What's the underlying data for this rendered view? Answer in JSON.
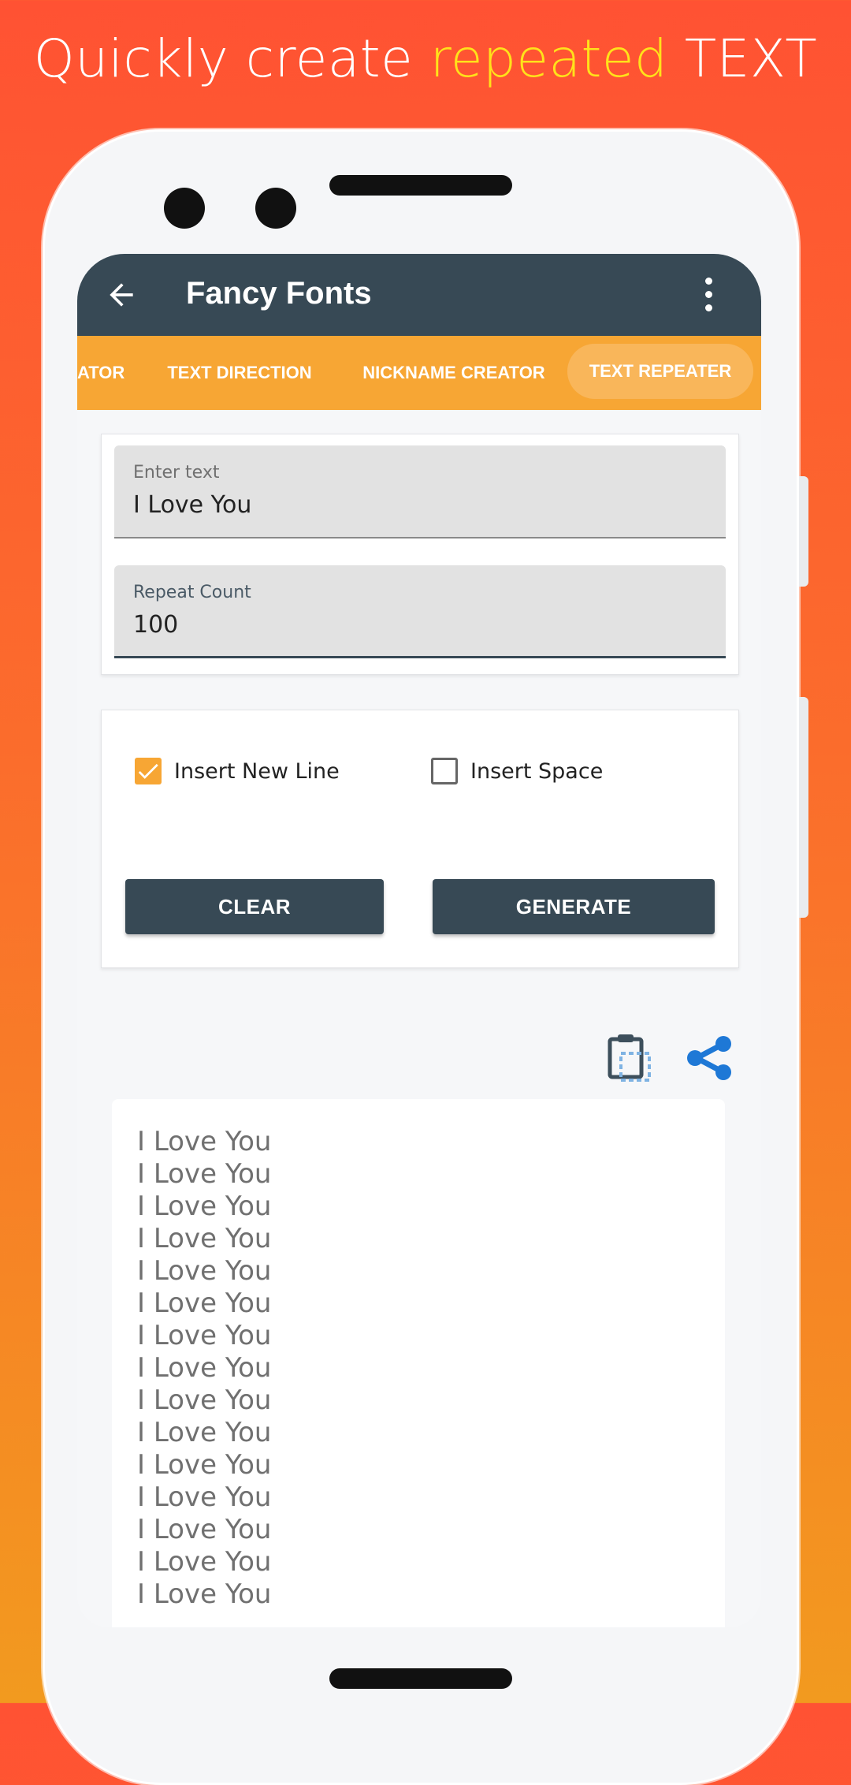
{
  "headline": {
    "part1": "Quickly create ",
    "highlight": "repeated",
    "part2": " TEXT"
  },
  "colors": {
    "appbar": "#374955",
    "tabbar": "#f7a634",
    "checkbox_on": "#f7a634",
    "share_icon": "#1e78d6",
    "headline_highlight": "#ffe21a"
  },
  "appbar": {
    "title": "Fancy Fonts",
    "back_icon": "arrow-left-icon",
    "menu_icon": "more-vert-icon"
  },
  "tabs": [
    {
      "label": "ATOR",
      "active": false
    },
    {
      "label": "TEXT DIRECTION",
      "active": false
    },
    {
      "label": "NICKNAME CREATOR",
      "active": false
    },
    {
      "label": "TEXT REPEATER",
      "active": true
    }
  ],
  "inputs": {
    "text": {
      "label": "Enter text",
      "value": "I Love You"
    },
    "count": {
      "label": "Repeat Count",
      "value": "100"
    }
  },
  "options": {
    "new_line": {
      "label": "Insert New Line",
      "checked": true
    },
    "space": {
      "label": "Insert Space",
      "checked": false
    }
  },
  "buttons": {
    "clear": "CLEAR",
    "generate": "GENERATE"
  },
  "output_actions": {
    "copy_icon": "clipboard-copy-icon",
    "share_icon": "share-icon"
  },
  "output": {
    "lines": [
      "I Love You",
      "I Love You",
      "I Love You",
      "I Love You",
      "I Love You",
      "I Love You",
      "I Love You",
      "I Love You",
      "I Love You",
      "I Love You",
      "I Love You",
      "I Love You",
      "I Love You",
      "I Love You",
      "I Love You"
    ]
  }
}
